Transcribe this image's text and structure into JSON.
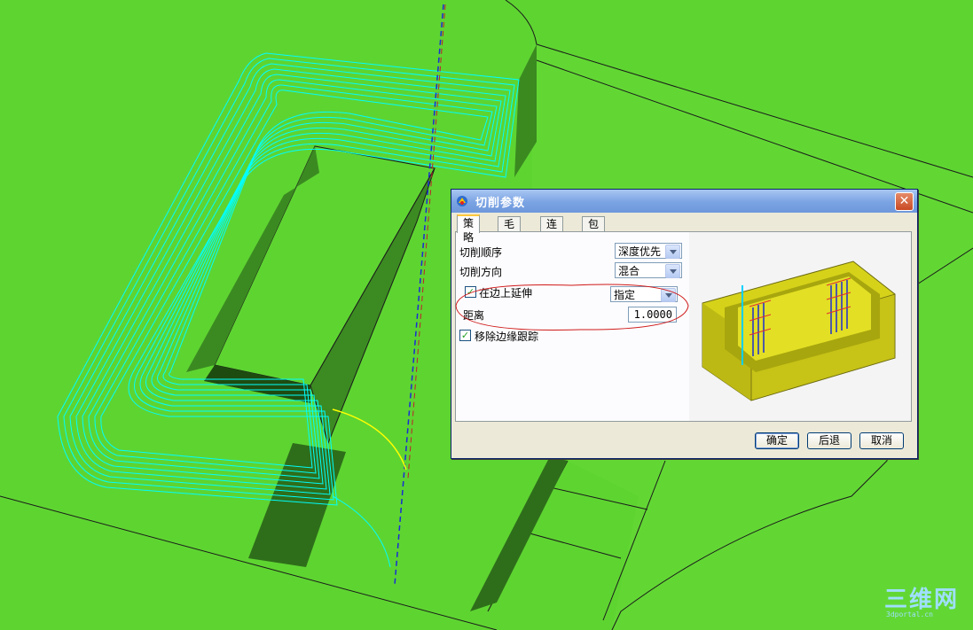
{
  "dialog": {
    "title": "切削参数",
    "close_label": "✕",
    "tabs": [
      "策略",
      "毛坯",
      "连接",
      "包容"
    ],
    "active_tab": "策略",
    "cut_order_label": "切削顺序",
    "cut_order_value": "深度优先",
    "cut_direction_label": "切削方向",
    "cut_direction_value": "混合",
    "extend_on_edge_label": "在边上延伸",
    "extend_on_edge_checked": true,
    "extend_mode_value": "指定",
    "distance_label": "距离",
    "distance_value": "1.0000",
    "remove_edge_trace_label": "移除边缘跟踪",
    "remove_edge_trace_checked": true,
    "ok_label": "确定",
    "back_label": "后退",
    "cancel_label": "取消"
  },
  "watermark": {
    "logo_text": "三维网",
    "sub_text": "3dportal.cn"
  },
  "colors": {
    "background": "#5ed431",
    "toolpath": "#00ffff",
    "highlight_circle": "#cc0000"
  }
}
